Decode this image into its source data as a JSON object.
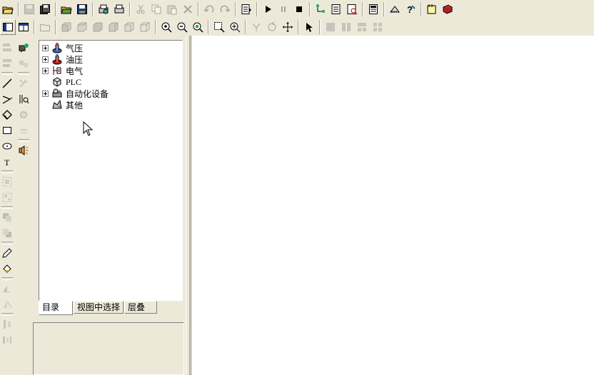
{
  "tree": {
    "items": [
      {
        "label": "气压",
        "icon": "pneumatic-icon",
        "expandable": true
      },
      {
        "label": "油压",
        "icon": "hydraulic-icon",
        "expandable": true
      },
      {
        "label": "电气",
        "icon": "electrical-icon",
        "expandable": true
      },
      {
        "label": "PLC",
        "icon": "plc-icon",
        "expandable": false
      },
      {
        "label": "自动化设备",
        "icon": "automation-icon",
        "expandable": true
      },
      {
        "label": "其他",
        "icon": "other-icon",
        "expandable": false
      }
    ]
  },
  "tabs": [
    {
      "label": "目录",
      "active": true
    },
    {
      "label": "视图中选择",
      "active": false
    },
    {
      "label": "层叠",
      "active": false
    }
  ],
  "toolbar1": [
    "open-icon",
    "save-disabled-icon",
    "save-all-icon",
    "open-folder-icon",
    "save-icon",
    "print-preview-icon",
    "print-icon",
    "cut-icon",
    "copy-icon",
    "paste-icon",
    "delete-icon",
    "undo-icon",
    "redo-icon",
    "properties-icon",
    "play-icon",
    "pause-icon",
    "stop-icon",
    "connect-icon",
    "report-icon",
    "inspect-icon",
    "page-icon",
    "ruler-icon",
    "help-icon",
    "folder-note-icon",
    "book-icon"
  ],
  "toolbar2": [
    "view-layout-icon",
    "view-split-icon",
    "folder-outline-icon",
    "cube-front-icon",
    "cube-back-icon",
    "cube-left-icon",
    "cube-right-icon",
    "cube-top-icon",
    "cube-iso-icon",
    "zoom-in-icon",
    "zoom-out-icon",
    "zoom-fit-icon",
    "zoom-window-icon",
    "zoom-region-icon",
    "snap-icon",
    "rotate-icon",
    "pan-icon",
    "select-icon",
    "tile-one-icon",
    "tile-two-icon",
    "tile-three-icon",
    "tile-four-icon"
  ],
  "colors": {
    "bg": "#ece9d8",
    "panel": "#ffffff"
  }
}
